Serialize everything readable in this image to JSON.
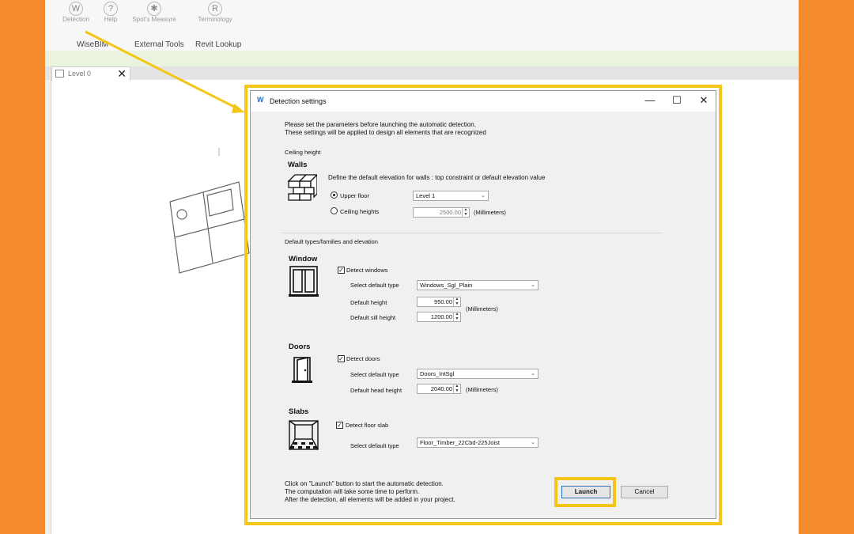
{
  "ribbon": {
    "buttons": [
      "Detection",
      "Help",
      "Spot's Measure",
      "Terminology"
    ],
    "panels": [
      "WiseBIM",
      "External Tools",
      "Revit Lookup"
    ]
  },
  "view_tab": {
    "label": "Level 0",
    "close": "✕"
  },
  "dialog": {
    "title": "Detection settings",
    "controls": {
      "minimize": "—",
      "maximize": "☐",
      "close": "✕"
    },
    "intro_line1": "Please set the parameters before launching the automatic detection.",
    "intro_line2": "These settings will be applied to design all elements that are recognized",
    "ceiling_group": "Ceiling height",
    "walls": {
      "heading": "Walls",
      "description": "Define the default elevation for walls : top constraint or default elevation value",
      "upper_floor_label": "Upper floor",
      "upper_floor_value": "Level 1",
      "ceiling_heights_label": "Ceiling heights",
      "ceiling_heights_value": "2500.00",
      "unit": "(Millimeters)"
    },
    "types_group": "Default types/families and elevation",
    "window": {
      "heading": "Window",
      "detect_label": "Detect windows",
      "type_label": "Select default type",
      "type_value": "Windows_Sgl_Plain",
      "height_label": "Default height",
      "height_value": "950.00",
      "sill_label": "Default sill height",
      "sill_value": "1200.00",
      "unit": "(Millimeters)"
    },
    "doors": {
      "heading": "Doors",
      "detect_label": "Detect doors",
      "type_label": "Select default type",
      "type_value": "Doors_IntSgl",
      "head_label": "Default head height",
      "head_value": "2040.00",
      "unit": "(Millimeters)"
    },
    "slabs": {
      "heading": "Slabs",
      "detect_label": "Detect floor slab",
      "type_label": "Select default type",
      "type_value": "Floor_Timber_22Cbd-225Joist"
    },
    "footer_line1": "Click on \"Launch\" button to start the automatic detection.",
    "footer_line2": "The computation will take some time to perform.",
    "footer_line3": "After the detection, all elements will be added in your project.",
    "launch_label": "Launch",
    "cancel_label": "Cancel"
  },
  "colors": {
    "background": "#f48a2e",
    "highlight": "#f5c518"
  }
}
